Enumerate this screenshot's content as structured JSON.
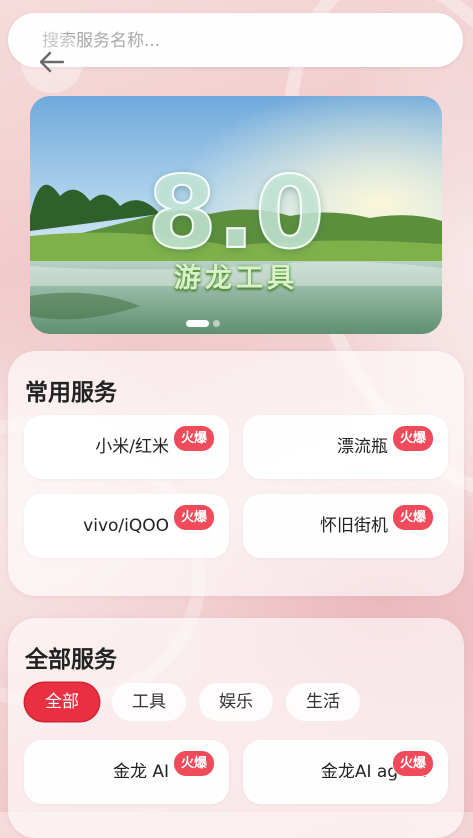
{
  "search": {
    "placeholder": "搜索服务名称..."
  },
  "banner": {
    "big_text": "8.0",
    "title": "游龙工具",
    "slide_count": 2,
    "active_slide": 1
  },
  "common_services": {
    "title": "常用服务",
    "items": [
      {
        "label": "小米/红米",
        "badge": "火爆"
      },
      {
        "label": "漂流瓶",
        "badge": "火爆"
      },
      {
        "label": "vivo/iQOO",
        "badge": "火爆"
      },
      {
        "label": "怀旧街机",
        "badge": "火爆"
      }
    ]
  },
  "all_services": {
    "title": "全部服务",
    "tabs": [
      {
        "label": "全部",
        "active": true
      },
      {
        "label": "工具",
        "active": false
      },
      {
        "label": "娱乐",
        "active": false
      },
      {
        "label": "生活",
        "active": false
      }
    ],
    "items": [
      {
        "label": "金龙 AI",
        "badge": "火爆"
      },
      {
        "label": "金龙AI agent",
        "badge": "火爆"
      }
    ]
  },
  "colors": {
    "accent": "#e83040",
    "badge": "#ef4b5a",
    "background": "#f3d3d4"
  },
  "icons": {
    "back": "arrow-left-icon"
  }
}
